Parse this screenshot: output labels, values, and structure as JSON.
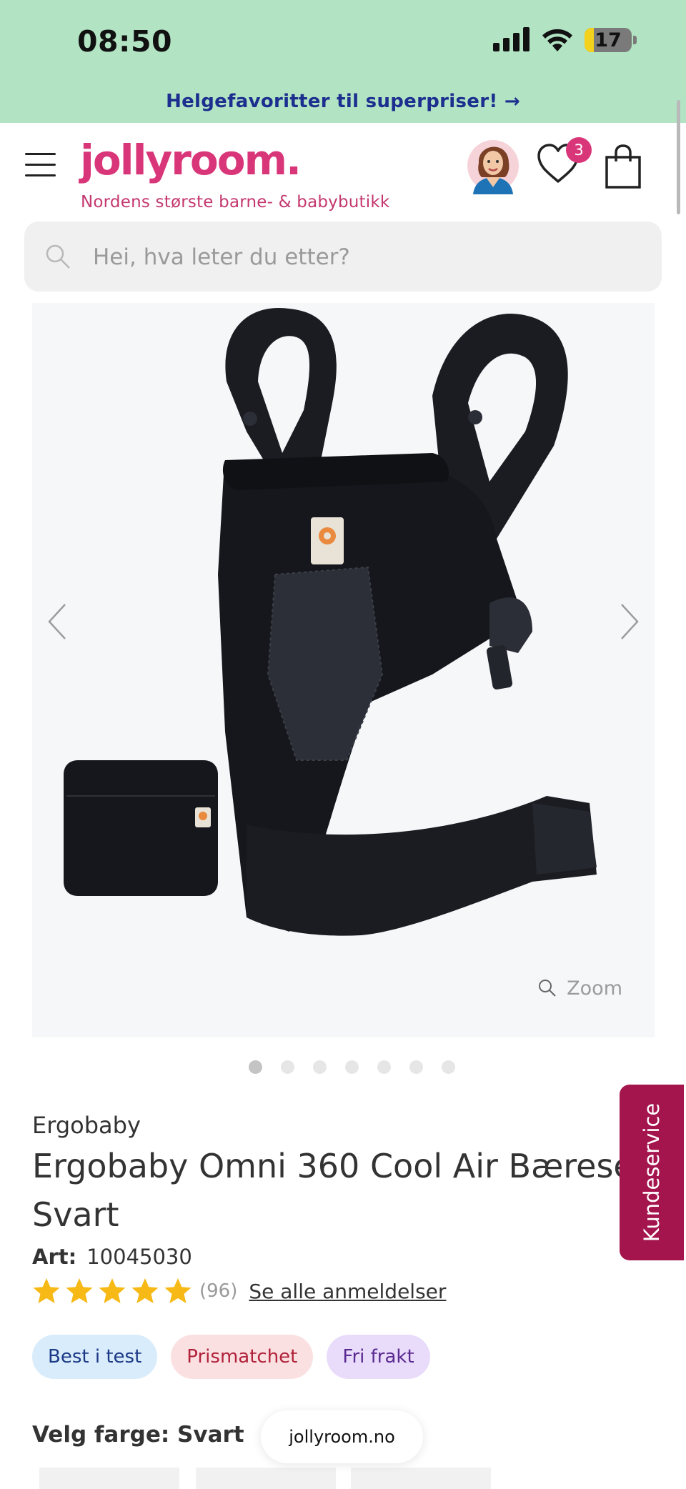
{
  "status_bar": {
    "time": "08:50",
    "battery": "17",
    "battery_level": 0.17
  },
  "promo": {
    "text": "Helgefavoritter til superpriser! →"
  },
  "header": {
    "logo": "jollyroom.",
    "tagline": "Nordens største barne- & babybutikk",
    "wishlist_count": "3",
    "brand_color": "#d9367a"
  },
  "search": {
    "placeholder": "Hei, hva leter du etter?"
  },
  "gallery": {
    "zoom_label": "Zoom",
    "image_count": 7,
    "active_index": 0
  },
  "product": {
    "brand": "Ergobaby",
    "title_line1": "Ergobaby Omni 360 Cool Air Bæresele",
    "title_line2": "Svart",
    "art_label": "Art:",
    "art_number": "10045030",
    "rating": 5,
    "review_count": "(96)",
    "reviews_link": "Se alle anmeldelser",
    "badges": [
      "Best i test",
      "Prismatchet",
      "Fri frakt"
    ],
    "color_label": "Velg farge: Svart"
  },
  "side_tab": {
    "label": "Kundeservice",
    "color": "#a4144d"
  },
  "browser": {
    "url": "jollyroom.no"
  }
}
